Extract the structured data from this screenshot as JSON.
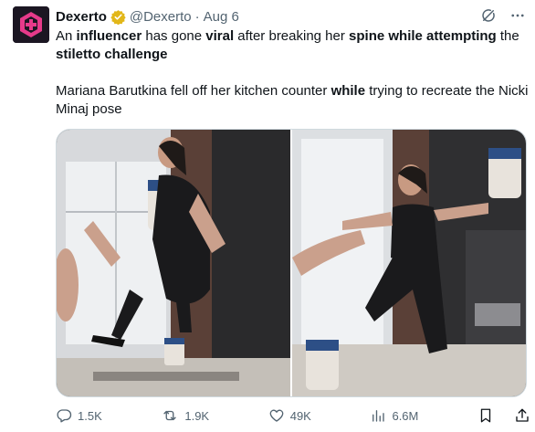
{
  "author": {
    "name": "Dexerto",
    "handle": "@Dexerto",
    "separator": "·",
    "date": "Aug 6"
  },
  "tweet": {
    "line1": [
      {
        "text": "An ",
        "bold": false
      },
      {
        "text": "influencer",
        "bold": true
      },
      {
        "text": " has gone ",
        "bold": false
      },
      {
        "text": "viral",
        "bold": true
      },
      {
        "text": " after breaking her ",
        "bold": false
      },
      {
        "text": "spine while attempting",
        "bold": true
      },
      {
        "text": " the ",
        "bold": false
      },
      {
        "text": "stiletto challenge",
        "bold": true
      }
    ],
    "line2": [
      {
        "text": "Mariana Barutkina fell off her kitchen counter ",
        "bold": false
      },
      {
        "text": "while",
        "bold": true
      },
      {
        "text": " trying to recreate the Nicki Minaj pose",
        "bold": false
      }
    ]
  },
  "actions": {
    "replies": "1.5K",
    "reposts": "1.9K",
    "likes": "49K",
    "views": "6.6M"
  },
  "icons": {
    "avatar": "dexerto-logo-icon",
    "verified": "verified-badge-icon",
    "grok": "grok-icon",
    "more": "more-icon",
    "reply": "reply-icon",
    "repost": "repost-icon",
    "like": "like-icon",
    "views": "views-icon",
    "bookmark": "bookmark-icon",
    "share": "share-icon"
  },
  "colors": {
    "accent_pink": "#e63a8a",
    "verified_gold": "#e2b719",
    "text_secondary": "#536471"
  }
}
